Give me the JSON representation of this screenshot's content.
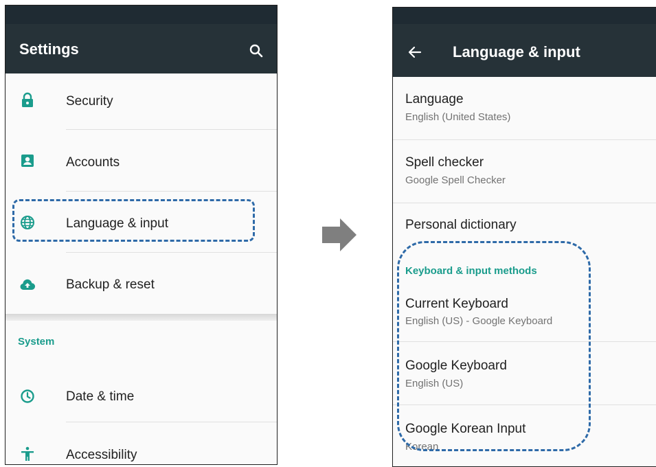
{
  "left_screen": {
    "title": "Settings",
    "search_icon": "search-icon",
    "items": [
      {
        "label": "Security",
        "icon": "lock-icon"
      },
      {
        "label": "Accounts",
        "icon": "account-box-icon"
      },
      {
        "label": "Language & input",
        "icon": "globe-icon"
      },
      {
        "label": "Backup & reset",
        "icon": "cloud-upload-icon"
      }
    ],
    "system_header": "System",
    "system_items": [
      {
        "label": "Date & time",
        "icon": "clock-icon"
      },
      {
        "label": "Accessibility",
        "icon": "accessibility-icon"
      }
    ]
  },
  "right_screen": {
    "title": "Language & input",
    "back_icon": "back-arrow-icon",
    "items": [
      {
        "title": "Language",
        "subtitle": "English (United States)"
      },
      {
        "title": "Spell checker",
        "subtitle": "Google Spell Checker"
      },
      {
        "title": "Personal dictionary"
      }
    ],
    "keyboard_header": "Keyboard & input methods",
    "keyboard_items": [
      {
        "title": "Current Keyboard",
        "subtitle": "English (US) - Google Keyboard"
      },
      {
        "title": "Google Keyboard",
        "subtitle": "English (US)"
      },
      {
        "title": "Google Korean Input",
        "subtitle": "Korean"
      }
    ]
  },
  "colors": {
    "appbar": "#263238",
    "statusbar": "#1f2b33",
    "accent": "#1a9c8c",
    "highlight": "#2e6aa8",
    "arrow": "#7f7f7f"
  }
}
